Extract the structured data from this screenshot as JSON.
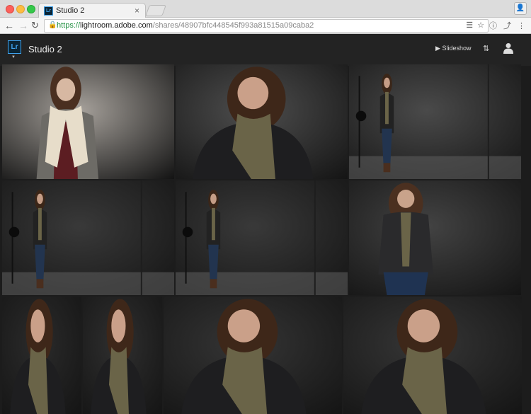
{
  "browser": {
    "tab": {
      "favicon": "Lr",
      "title": "Studio 2",
      "close": "×"
    },
    "url": {
      "scheme": "https://",
      "host": "lightroom.adobe.com",
      "path": "/shares/48907bfc448545f993a81515a09caba2"
    }
  },
  "app": {
    "logo": "Lr",
    "title": "Studio 2",
    "slideshow_label": "Slideshow",
    "accent_color": "#3fa3ef"
  },
  "gallery": {
    "photos": [
      {
        "name": "photo-1",
        "subject": "portrait-cream-scarf",
        "backdrop": "#a5a09a"
      },
      {
        "name": "photo-2",
        "subject": "closeup-olive-scarf",
        "backdrop": "#4e4e4e"
      },
      {
        "name": "photo-3",
        "subject": "fullbody-studio-light",
        "backdrop": "#4a4a4a"
      },
      {
        "name": "photo-4",
        "subject": "fullbody-studio-light",
        "backdrop": "#393939"
      },
      {
        "name": "photo-5",
        "subject": "fullbody-studio-light",
        "backdrop": "#393939"
      },
      {
        "name": "photo-6",
        "subject": "threequarter-olive-scarf",
        "backdrop": "#434343"
      },
      {
        "name": "photo-7",
        "subject": "closeup-olive-scarf",
        "backdrop": "#2b2b2b"
      },
      {
        "name": "photo-8",
        "subject": "closeup-olive-scarf",
        "backdrop": "#2f2f2f"
      },
      {
        "name": "photo-9",
        "subject": "closeup-olive-scarf",
        "backdrop": "#353535"
      },
      {
        "name": "photo-10",
        "subject": "closeup-olive-scarf",
        "backdrop": "#363636"
      }
    ]
  }
}
